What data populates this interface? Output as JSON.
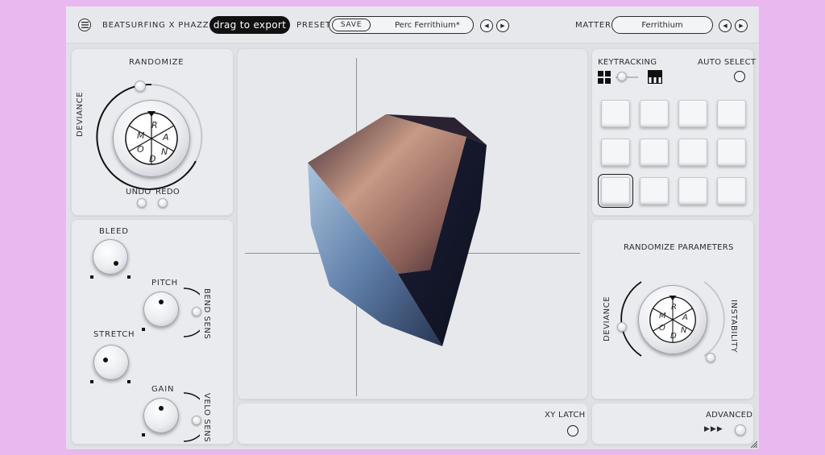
{
  "header": {
    "menu_icon": "menu-icon",
    "brand": "BEATSURFING X PHAZZ",
    "export_label": "drag to export",
    "preset_label": "PRESET",
    "save_label": "SAVE",
    "preset_name": "Perc Ferrithium*",
    "matter_label": "MATTER",
    "matter_name": "Ferrithium"
  },
  "randomize": {
    "title": "RANDOMIZE",
    "deviance_label": "DEVIANCE",
    "undo_label": "UNDO",
    "redo_label": "REDO",
    "dice_letters": [
      "R",
      "A",
      "N",
      "D",
      "O",
      "M"
    ]
  },
  "controls": {
    "bleed_label": "BLEED",
    "pitch_label": "PITCH",
    "bend_sens_label": "BEND SENS",
    "stretch_label": "STRETCH",
    "gain_label": "GAIN",
    "velo_sens_label": "VELO SENS"
  },
  "keytracking": {
    "label": "KEYTRACKING",
    "auto_select_label": "AUTO SELECT",
    "grid_icon": "grid-icon",
    "piano_icon": "piano-icon",
    "pads_count_visible": 12
  },
  "randomize_params": {
    "title": "RANDOMIZE PARAMETERS",
    "deviance_label": "DEVIANCE",
    "instability_label": "INSTABILITY",
    "dice_letters": [
      "R",
      "A",
      "N",
      "D",
      "O",
      "M"
    ]
  },
  "viewer": {
    "xy_latch_label": "XY LATCH"
  },
  "advanced": {
    "label": "ADVANCED",
    "arrows": "▶▶▶"
  },
  "colors": {
    "background": "#e8b8ee",
    "panel": "#e9ebef",
    "accent": "#111111"
  }
}
